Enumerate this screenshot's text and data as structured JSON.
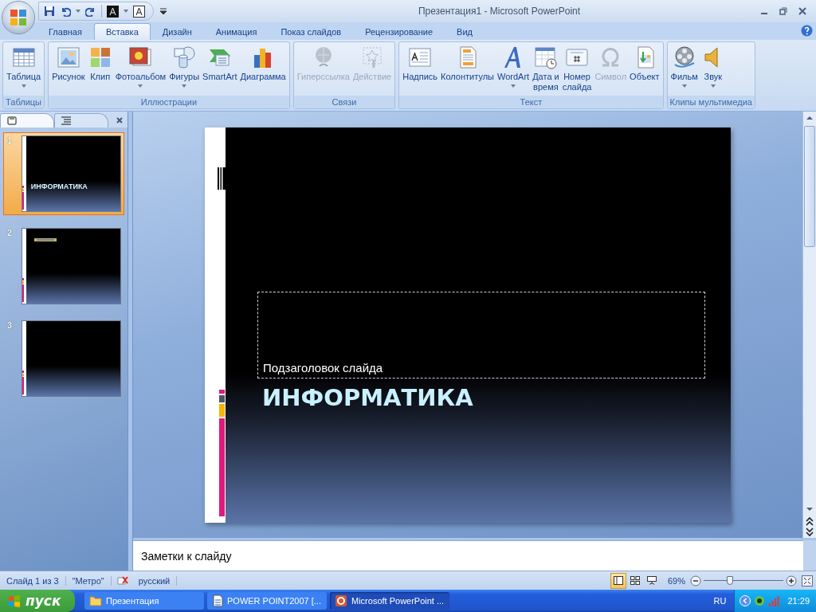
{
  "window": {
    "title": "Презентация1 - Microsoft PowerPoint"
  },
  "tabs": [
    {
      "label": "Главная",
      "selected": false
    },
    {
      "label": "Вставка",
      "selected": true
    },
    {
      "label": "Дизайн",
      "selected": false
    },
    {
      "label": "Анимация",
      "selected": false
    },
    {
      "label": "Показ слайдов",
      "selected": false
    },
    {
      "label": "Рецензирование",
      "selected": false
    },
    {
      "label": "Вид",
      "selected": false
    }
  ],
  "ribbon_groups": [
    {
      "label": "Таблицы",
      "buttons": [
        {
          "label": "Таблица",
          "dropdown": true,
          "disabled": false
        }
      ]
    },
    {
      "label": "Иллюстрации",
      "buttons": [
        {
          "label": "Рисунок",
          "dropdown": false,
          "disabled": false
        },
        {
          "label": "Клип",
          "dropdown": false,
          "disabled": false
        },
        {
          "label": "Фотоальбом",
          "dropdown": true,
          "disabled": false
        },
        {
          "label": "Фигуры",
          "dropdown": true,
          "disabled": false
        },
        {
          "label": "SmartArt",
          "dropdown": false,
          "disabled": false
        },
        {
          "label": "Диаграмма",
          "dropdown": false,
          "disabled": false
        }
      ]
    },
    {
      "label": "Связи",
      "buttons": [
        {
          "label": "Гиперссылка",
          "dropdown": false,
          "disabled": true
        },
        {
          "label": "Действие",
          "dropdown": false,
          "disabled": true
        }
      ]
    },
    {
      "label": "Текст",
      "buttons": [
        {
          "label": "Надпись",
          "dropdown": false,
          "disabled": false
        },
        {
          "label": "Колонтитулы",
          "dropdown": false,
          "disabled": false
        },
        {
          "label": "WordArt",
          "dropdown": true,
          "disabled": false
        },
        {
          "label": "Дата и\nвремя",
          "dropdown": false,
          "disabled": false
        },
        {
          "label": "Номер\nслайда",
          "dropdown": false,
          "disabled": false
        },
        {
          "label": "Символ",
          "dropdown": false,
          "disabled": true
        },
        {
          "label": "Объект",
          "dropdown": false,
          "disabled": false
        }
      ]
    },
    {
      "label": "Клипы мультимедиа",
      "buttons": [
        {
          "label": "Фильм",
          "dropdown": true,
          "disabled": false
        },
        {
          "label": "Звук",
          "dropdown": true,
          "disabled": false
        }
      ]
    }
  ],
  "slides_pane": {
    "tabs": [
      {
        "selected": true
      },
      {
        "selected": false
      }
    ],
    "slides": [
      {
        "number": "1",
        "selected": true,
        "title": "ИНФОРМАТИКА",
        "title_blurred": false
      },
      {
        "number": "2",
        "selected": false,
        "title_blurred": true
      },
      {
        "number": "3",
        "selected": false,
        "title_blurred": false
      }
    ]
  },
  "slide": {
    "subtitle_placeholder": "Подзаголовок слайда",
    "title": "ИНФОРМАТИКА"
  },
  "notes": {
    "placeholder": "Заметки к слайду"
  },
  "status_bar": {
    "slide_info": "Слайд 1 из 3",
    "theme": "\"Метро\"",
    "language": "русский",
    "views": [
      {
        "selected": true
      },
      {
        "selected": false
      },
      {
        "selected": false
      }
    ],
    "zoom": "69%",
    "level": 0.33
  },
  "taskbar": {
    "start": "пуск",
    "tasks": [
      {
        "label": "Презентация",
        "selected": false
      },
      {
        "label": "POWER POINT2007 [...",
        "selected": false
      },
      {
        "label": "Microsoft PowerPoint ...",
        "selected": true
      }
    ],
    "language": "RU",
    "clock": "21:29"
  }
}
